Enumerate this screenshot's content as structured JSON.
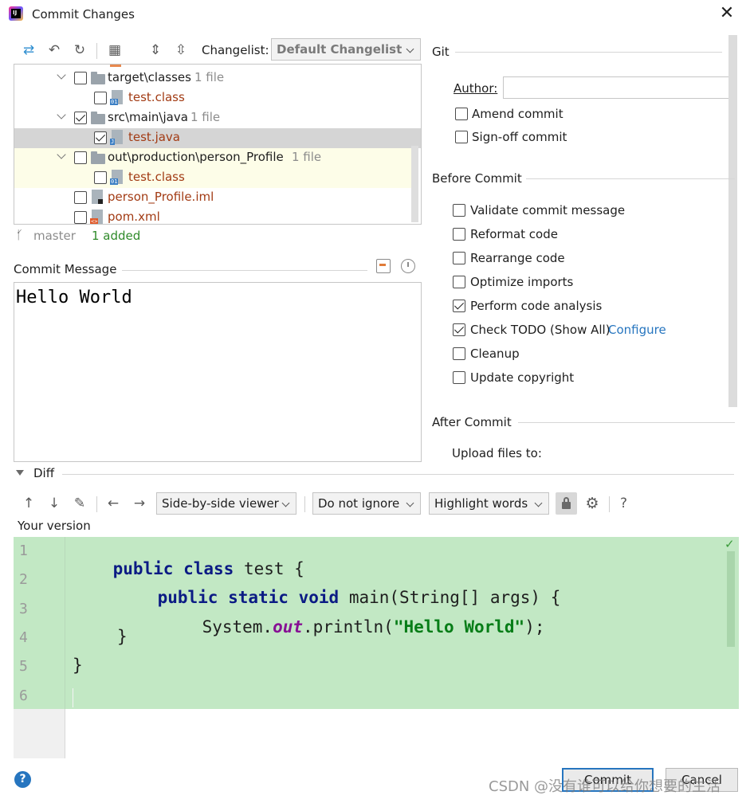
{
  "window": {
    "title": "Commit Changes"
  },
  "toolbar": {
    "changelist_label": "Changelist:",
    "changelist_value": "Default Changelist"
  },
  "tree": {
    "rows": [
      {
        "name": "target\\classes",
        "count": "1 file"
      },
      {
        "name": "test.class"
      },
      {
        "name": "src\\main\\java",
        "count": "1 file"
      },
      {
        "name": "test.java"
      },
      {
        "name": "out\\production\\person_Profile",
        "count": "1 file"
      },
      {
        "name": "test.class"
      },
      {
        "name": "person_Profile.iml"
      },
      {
        "name": "pom.xml"
      }
    ],
    "icon_tags": {
      "class": "01",
      "java": "J",
      "xml": "<>"
    }
  },
  "status": {
    "branch": "master",
    "summary": "1 added"
  },
  "commit_message": {
    "label": "Commit Message",
    "value": "Hello World"
  },
  "git": {
    "section": "Git",
    "author_label": "Author:",
    "author_value": "",
    "amend": "Amend commit",
    "signoff": "Sign-off commit"
  },
  "before_commit": {
    "section": "Before Commit",
    "items": [
      {
        "label": "Validate commit message",
        "checked": false
      },
      {
        "label": "Reformat code",
        "checked": false
      },
      {
        "label": "Rearrange code",
        "checked": false
      },
      {
        "label": "Optimize imports",
        "checked": false
      },
      {
        "label": "Perform code analysis",
        "checked": true
      },
      {
        "label": "Check TODO (Show All)",
        "checked": true,
        "link": "Configure"
      },
      {
        "label": "Cleanup",
        "checked": false
      },
      {
        "label": "Update copyright",
        "checked": false
      }
    ]
  },
  "after_commit": {
    "section": "After Commit",
    "upload_label": "Upload files to:"
  },
  "diff": {
    "label": "Diff",
    "viewer": "Side-by-side viewer",
    "ignore": "Do not ignore",
    "highlight": "Highlight words",
    "help": "?",
    "your_version": "Your version",
    "line_numbers": [
      "1",
      "2",
      "3",
      "4",
      "5",
      "6"
    ],
    "code": {
      "l1_kw1": "public",
      "l1_kw2": "class",
      "l1_rest": " test {",
      "l2_kw1": "public",
      "l2_kw2": "static",
      "l2_kw3": "void",
      "l2_rest": " main(String[] args) {",
      "l3_a": "System.",
      "l3_fld": "out",
      "l3_b": ".println(",
      "l3_str": "\"Hello World\"",
      "l3_c": ");",
      "l4": "}",
      "l5": "}"
    }
  },
  "buttons": {
    "commit": "Commit",
    "cancel": "Cancel",
    "help": "?"
  },
  "watermark": "CSDN @没有谁可以给你想要的生活",
  "colors": {
    "accent": "#2675bf",
    "diff_bg": "#c2e8c4",
    "selected_row": "#d5d5d5",
    "changed_row": "#fdfde8"
  }
}
